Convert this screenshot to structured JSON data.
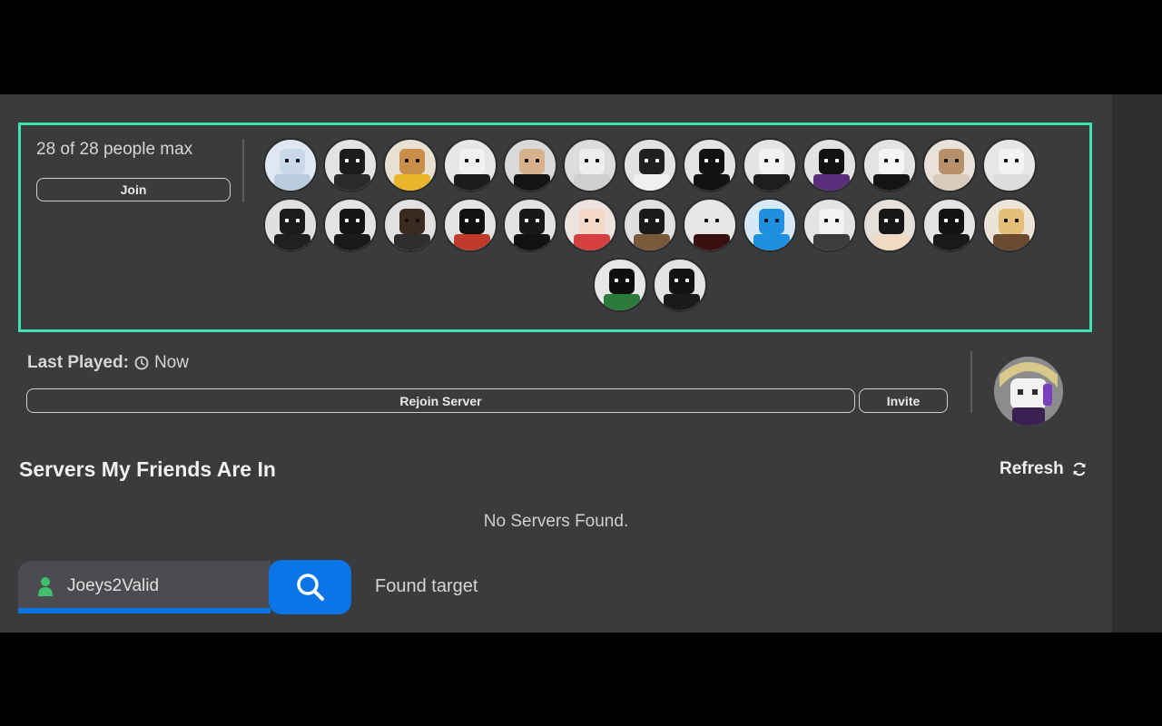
{
  "server": {
    "count_text": "28 of 28 people max",
    "join_label": "Join",
    "accent_color": "#3fe3b0",
    "players": [
      {
        "bg": "#dfe8f2",
        "head": "#c9d9ea",
        "body": "#b9cce0"
      },
      {
        "bg": "#e3e3e3",
        "head": "#1c1c1c",
        "body": "#2b2b2b"
      },
      {
        "bg": "#e8e0d0",
        "head": "#c98f4a",
        "body": "#e8b52b"
      },
      {
        "bg": "#e6e6e6",
        "head": "#f1f1f1",
        "body": "#1d1d1d"
      },
      {
        "bg": "#d9d9d9",
        "head": "#d7b08e",
        "body": "#141414"
      },
      {
        "bg": "#dcdcdc",
        "head": "#eeeeee",
        "body": "#cfcfcf"
      },
      {
        "bg": "#e2e2e2",
        "head": "#202020",
        "body": "#f0f0f0"
      },
      {
        "bg": "#e3e3e3",
        "head": "#111111",
        "body": "#111111"
      },
      {
        "bg": "#e4e4e4",
        "head": "#f2f2f2",
        "body": "#1e1e1e"
      },
      {
        "bg": "#e2e2e2",
        "head": "#111111",
        "body": "#5a2d7a"
      },
      {
        "bg": "#e3e3e3",
        "head": "#f5f5f5",
        "body": "#151515"
      },
      {
        "bg": "#e8e2da",
        "head": "#b7906b",
        "body": "#d9cbbb"
      },
      {
        "bg": "#e6e6e6",
        "head": "#f3f3f3",
        "body": "#dcdcdc"
      },
      {
        "bg": "#e0e0e0",
        "head": "#1b1b1b",
        "body": "#202020"
      },
      {
        "bg": "#e3e3e3",
        "head": "#141414",
        "body": "#1a1a1a"
      },
      {
        "bg": "#e1e1e1",
        "head": "#3a2a20",
        "body": "#2e2e2e"
      },
      {
        "bg": "#e3e3e3",
        "head": "#111111",
        "body": "#c0392b"
      },
      {
        "bg": "#e2e2e2",
        "head": "#181818",
        "body": "#121212"
      },
      {
        "bg": "#ede3df",
        "head": "#f4d9c8",
        "body": "#d64040"
      },
      {
        "bg": "#e0e0e0",
        "head": "#1a1a1a",
        "body": "#7a5a3a"
      },
      {
        "bg": "#e6e6e6",
        "head": "#e6e6e6",
        "body": "#3a1010"
      },
      {
        "bg": "#d7e9f6",
        "head": "#1f8fe0",
        "body": "#1f8fe0"
      },
      {
        "bg": "#e3e3e3",
        "head": "#f2f2f2",
        "body": "#3c3c3c"
      },
      {
        "bg": "#e6e0da",
        "head": "#171717",
        "body": "#f2d9c4"
      },
      {
        "bg": "#e3e3e3",
        "head": "#121212",
        "body": "#191919"
      },
      {
        "bg": "#ece4d8",
        "head": "#e2c07a",
        "body": "#6b4a30"
      },
      {
        "bg": "#e6e6e6",
        "head": "#0e0e0e",
        "body": "#2a7a3a"
      },
      {
        "bg": "#e3e3e3",
        "head": "#121212",
        "body": "#1a1a1a"
      }
    ]
  },
  "last_played": {
    "label": "Last Played:",
    "value": "Now",
    "rejoin_label": "Rejoin Server",
    "invite_label": "Invite"
  },
  "friends": {
    "title": "Servers My Friends Are In",
    "refresh_label": "Refresh",
    "empty_text": "No Servers Found."
  },
  "search": {
    "value": "Joeys2Valid",
    "status_text": "Found target",
    "accent_color": "#0b74e6",
    "user_icon_color": "#3fbf6a"
  }
}
